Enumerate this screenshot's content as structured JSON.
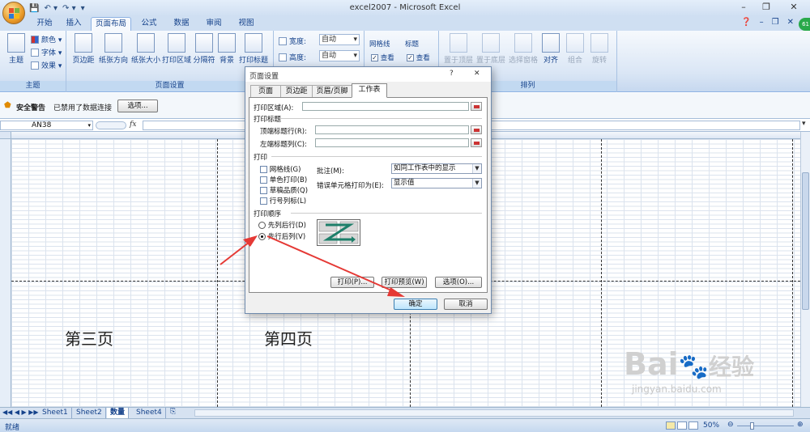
{
  "window": {
    "title": "excel2007 - Microsoft Excel",
    "min": "–",
    "restore": "❐",
    "close": "✕"
  },
  "qat": {
    "save": "💾",
    "undo": "↶ ▾",
    "redo": "↷ ▾",
    "customize": "▾"
  },
  "tabs": [
    "开始",
    "插入",
    "页面布局",
    "公式",
    "数据",
    "审阅",
    "视图"
  ],
  "active_tab": "页面布局",
  "user_badge": "61",
  "ribbon": {
    "theme_group": {
      "label": "主题",
      "theme": "主题",
      "colors": "颜色 ▾",
      "fonts": "字体 ▾",
      "effects": "效果 ▾"
    },
    "page_setup_group": {
      "label": "页面设置",
      "buttons": [
        "页边距",
        "纸张方向",
        "纸张大小",
        "打印区域",
        "分隔符",
        "背景",
        "打印标题"
      ]
    },
    "scale_group": {
      "width_label": "宽度:",
      "width_value": "自动",
      "height_label": "高度:",
      "height_value": "自动"
    },
    "sheet_options": {
      "gridlines": "网格线",
      "gridlines_view": "查看",
      "headings": "标题",
      "headings_view": "查看"
    },
    "arrange_group": {
      "label": "排列",
      "buttons": [
        "置于顶层",
        "置于底层",
        "选择窗格",
        "对齐",
        "组合",
        "旋转"
      ]
    }
  },
  "security": {
    "title": "安全警告",
    "message": "已禁用了数据连接",
    "options_button": "选项..."
  },
  "formula_bar": {
    "name_box": "AN38",
    "fx": "fx"
  },
  "sheet": {
    "page3": "第三页",
    "page4": "第四页"
  },
  "sheet_tabs": [
    "Sheet1",
    "Sheet2",
    "数量",
    "Sheet4"
  ],
  "active_sheet": "数量",
  "status": {
    "ready": "就绪",
    "zoom": "50%"
  },
  "dialog": {
    "title": "页面设置",
    "help": "?",
    "close": "✕",
    "tabs": [
      "页面",
      "页边距",
      "页眉/页脚",
      "工作表"
    ],
    "active_tab": "工作表",
    "print_area_label": "打印区域(A):",
    "print_titles_label": "打印标题",
    "rows_repeat_label": "顶端标题行(R):",
    "cols_repeat_label": "左端标题列(C):",
    "print_label": "打印",
    "gridlines": "网格线(G)",
    "black_white": "单色打印(B)",
    "draft": "草稿品质(Q)",
    "row_col_headings": "行号列标(L)",
    "comments_label": "批注(M):",
    "comments_value": "如同工作表中的显示",
    "errors_label": "错误单元格打印为(E):",
    "errors_value": "显示值",
    "order_label": "打印顺序",
    "down_then_over": "先列后行(D)",
    "over_then_down": "先行后列(V)",
    "selected_order": "先行后列(V)",
    "print_button": "打印(P)...",
    "preview_button": "打印预览(W)",
    "options_button": "选项(O)...",
    "ok_button": "确定",
    "cancel_button": "取消"
  },
  "watermark": {
    "brand": "Bai",
    "brand_cn": "经验",
    "url": "jingyan.baidu.com"
  }
}
